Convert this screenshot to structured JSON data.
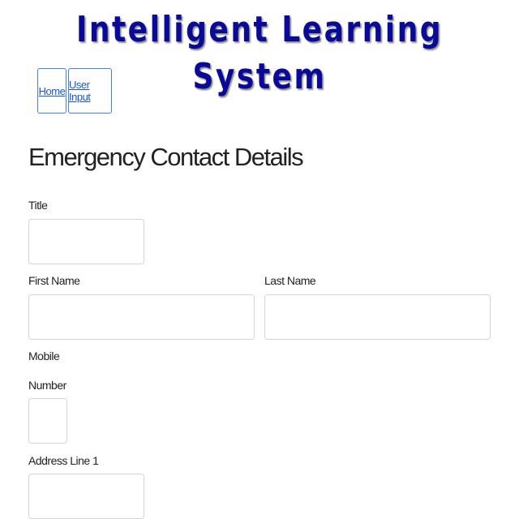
{
  "app_title": "Intelligent Learning System",
  "nav": {
    "home_label": "Home",
    "user_input_label": "User Input"
  },
  "section_title": "Emergency Contact Details",
  "fields": {
    "title": {
      "label": "Title",
      "value": ""
    },
    "first_name": {
      "label": "First Name",
      "value": ""
    },
    "last_name": {
      "label": "Last Name",
      "value": ""
    },
    "mobile_number": {
      "label_line1": "Mobile",
      "label_line2": "Number",
      "value": ""
    },
    "address_line_1": {
      "label": "Address Line 1",
      "value": ""
    }
  },
  "colors": {
    "title_color": "#0a0a9a",
    "link_color": "#1a56db",
    "nav_border": "#3b82f6",
    "input_border": "#d4d4d4"
  }
}
